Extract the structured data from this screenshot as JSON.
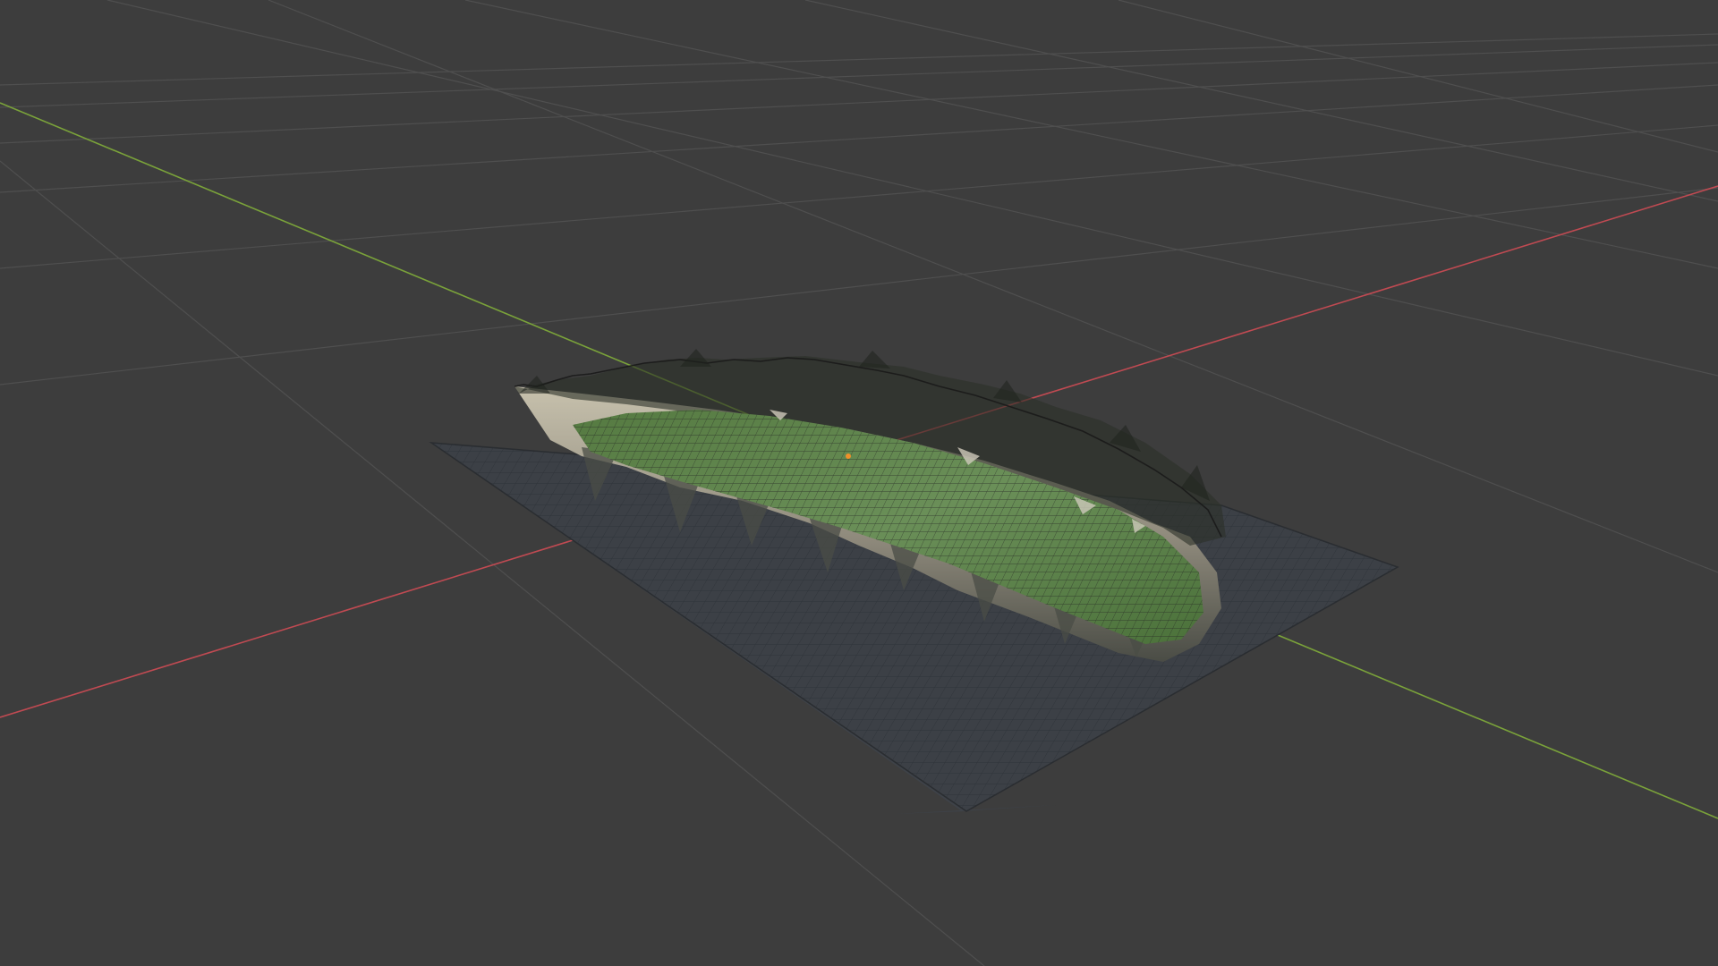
{
  "viewport": {
    "background_color": "#3d3d3d",
    "grid_color": "#4f4f4f",
    "x_axis_color": "#c04a52",
    "y_axis_color": "#7aa23a",
    "mesh_wire_color": "#1a1a1a",
    "terrain_green": "#4f7a3c",
    "terrain_rock": "#b3ab98",
    "terrain_shadow": "#3a3e36",
    "origin_marker_color": "#f0902a",
    "objects": [
      {
        "name": "ground-plane",
        "type": "mesh-plane"
      },
      {
        "name": "terrain-landscape",
        "type": "mesh-terrain"
      }
    ]
  }
}
